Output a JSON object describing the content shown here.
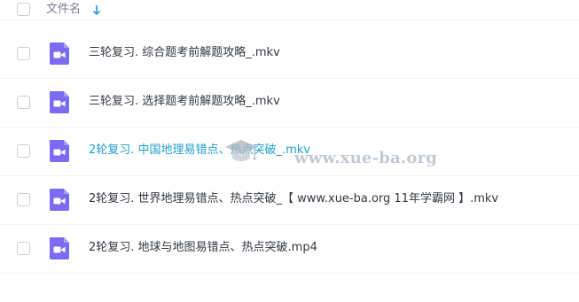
{
  "header": {
    "column_label": "文件名",
    "sort_icon": "arrow-down-icon",
    "accent_color": "#3aa0d8"
  },
  "files": [
    {
      "name": "三轮复习. 综合题考前解题攻略_.mkv",
      "icon": "video-file-icon"
    },
    {
      "name": "三轮复习. 选择题考前解题攻略_.mkv",
      "icon": "video-file-icon"
    },
    {
      "name": "2轮复习. 中国地理易错点、热点突破_.mkv",
      "icon": "video-file-icon",
      "hovered": true
    },
    {
      "name": "2轮复习. 世界地理易错点、热点突破_【 www.xue-ba.org 11年学霸网 】.mkv",
      "icon": "video-file-icon"
    },
    {
      "name": "2轮复习. 地球与地图易错点、热点突破.mp4",
      "icon": "video-file-icon"
    }
  ],
  "watermark": {
    "text": "www.xue-ba.org",
    "icon": "graduation-cap-icon"
  },
  "colors": {
    "video_icon": "#7b6bf2",
    "hover_text": "#1fa0c9",
    "text": "#333840"
  }
}
